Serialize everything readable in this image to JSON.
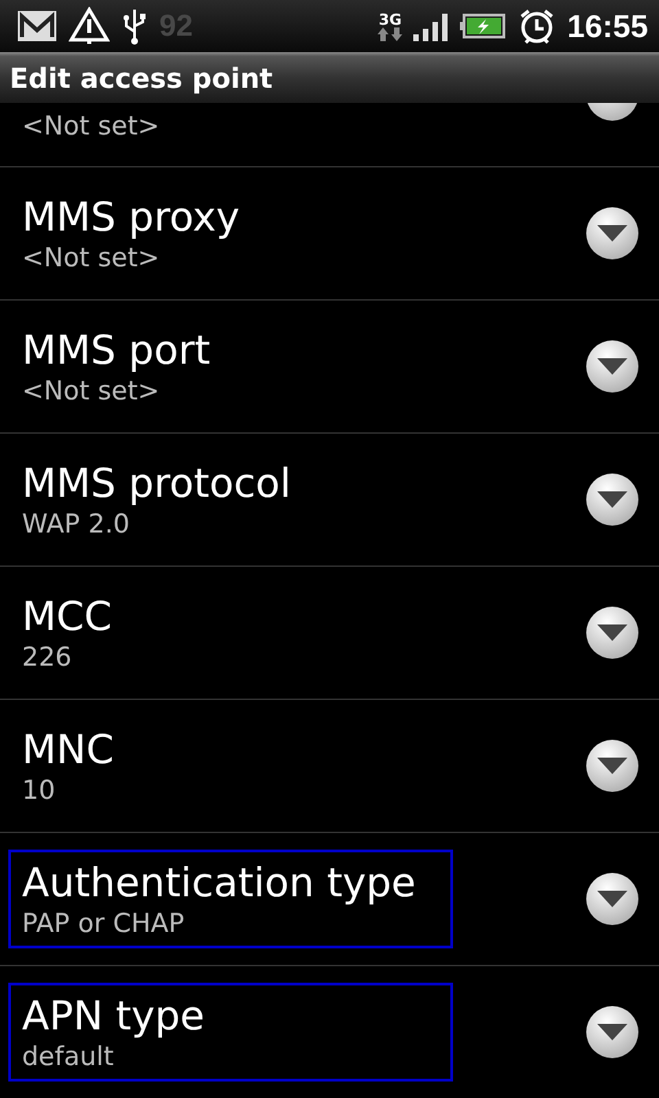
{
  "status_bar": {
    "battery_text": "92",
    "network": "3G",
    "time": "16:55"
  },
  "title": "Edit access point",
  "items": [
    {
      "kind": "partial",
      "summary": "<Not set>",
      "highlighted": false
    },
    {
      "kind": "full",
      "title": "MMS proxy",
      "summary": "<Not set>",
      "highlighted": false
    },
    {
      "kind": "full",
      "title": "MMS port",
      "summary": "<Not set>",
      "highlighted": false
    },
    {
      "kind": "full",
      "title": "MMS protocol",
      "summary": "WAP 2.0",
      "highlighted": false
    },
    {
      "kind": "full",
      "title": "MCC",
      "summary": "226",
      "highlighted": false
    },
    {
      "kind": "full",
      "title": "MNC",
      "summary": "10",
      "highlighted": false
    },
    {
      "kind": "full",
      "title": "Authentication type",
      "summary": "PAP or CHAP",
      "highlighted": true
    },
    {
      "kind": "full",
      "title": "APN type",
      "summary": "default",
      "highlighted": true
    }
  ]
}
